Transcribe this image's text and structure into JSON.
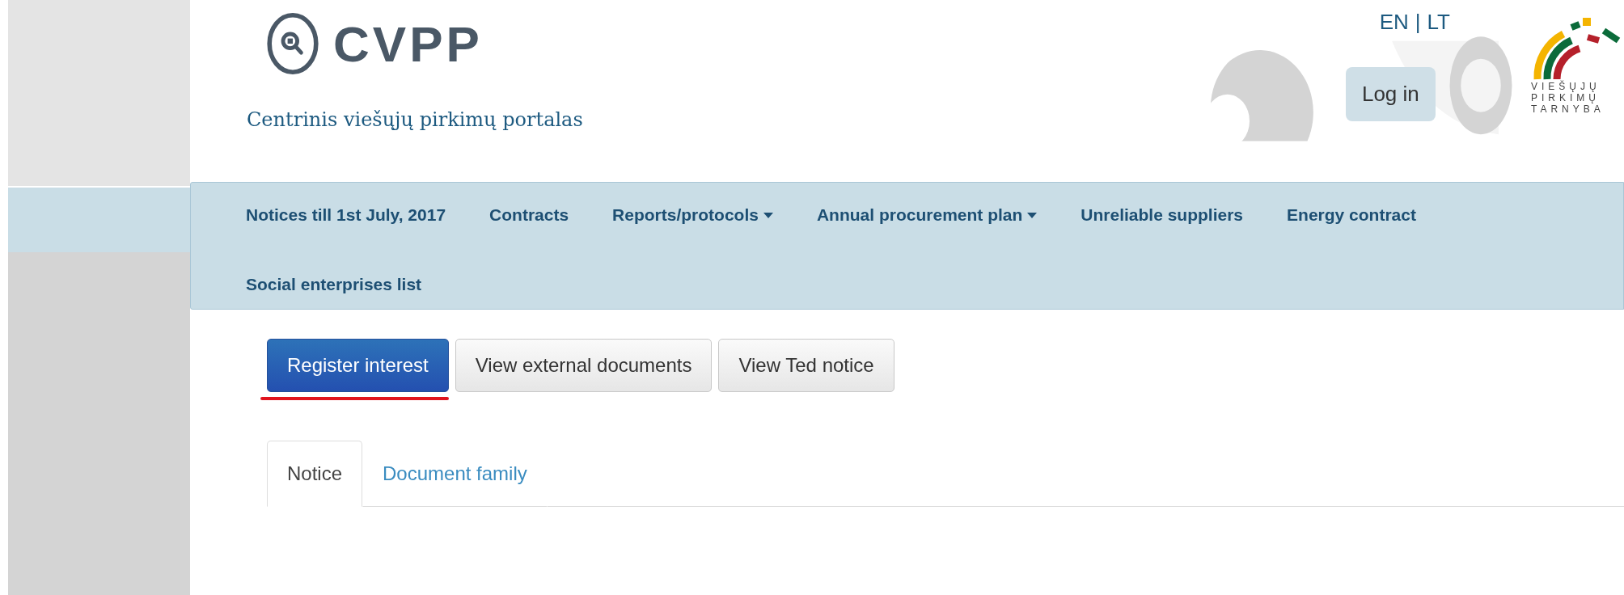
{
  "header": {
    "logo_text": "CVPP",
    "tagline": "Centrinis viešųjų pirkimų portalas",
    "languages": [
      {
        "label": "EN"
      },
      {
        "label": "LT"
      }
    ],
    "language_separator": "|",
    "login_button": "Log in",
    "agency_logo_lines": [
      "VIEŠŲJŲ",
      "PIRKIMŲ",
      "TARNYBA"
    ]
  },
  "nav": {
    "rows": [
      [
        {
          "label": "Notices till 1st July, 2017",
          "dropdown": false
        },
        {
          "label": "Contracts",
          "dropdown": false
        },
        {
          "label": "Reports/protocols",
          "dropdown": true
        },
        {
          "label": "Annual procurement plan",
          "dropdown": true
        },
        {
          "label": "Unreliable suppliers",
          "dropdown": false
        },
        {
          "label": "Energy contract",
          "dropdown": false
        }
      ],
      [
        {
          "label": "Social enterprises list",
          "dropdown": false
        }
      ]
    ]
  },
  "actions": [
    {
      "label": "Register interest",
      "kind": "primary",
      "highlighted": true
    },
    {
      "label": "View external documents",
      "kind": "default",
      "highlighted": false
    },
    {
      "label": "View Ted notice",
      "kind": "default",
      "highlighted": false
    }
  ],
  "tabs": [
    {
      "label": "Notice",
      "selected": true
    },
    {
      "label": "Document family",
      "selected": false
    }
  ]
}
